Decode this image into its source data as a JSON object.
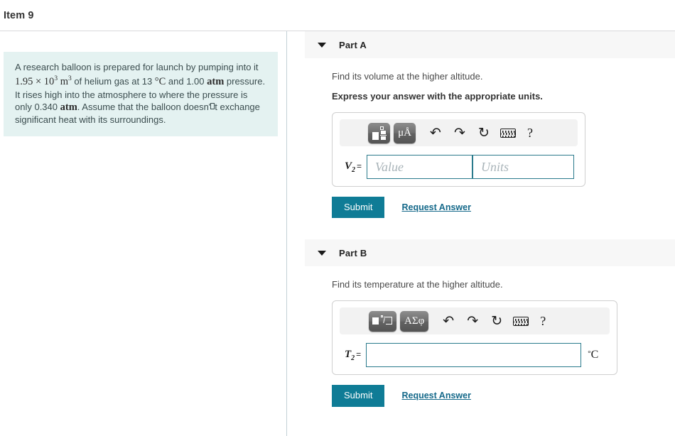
{
  "header": {
    "title": "Item 9"
  },
  "problem": {
    "segments": [
      {
        "type": "text",
        "value": "A research balloon is prepared for launch by pumping into it "
      },
      {
        "type": "math",
        "value": "1.95 × 10"
      },
      {
        "type": "math_sup",
        "value": "3"
      },
      {
        "type": "math_bold",
        "value": " m"
      },
      {
        "type": "math_bold_sup",
        "value": "3"
      },
      {
        "type": "text",
        "value": " of helium gas at 13 "
      },
      {
        "type": "math",
        "value": "°C"
      },
      {
        "type": "text",
        "value": " and 1.00 "
      },
      {
        "type": "math_bold",
        "value": "atm"
      },
      {
        "type": "text",
        "value": " pressure. It rises high into the atmosphere to where the pressure is only 0.340 "
      },
      {
        "type": "math_bold",
        "value": "atm"
      },
      {
        "type": "text",
        "value": ". Assume that the balloon doesn'"
      },
      {
        "type": "missing_glyph",
        "value": ""
      },
      {
        "type": "text",
        "value": "t exchange significant heat with its surroundings."
      }
    ],
    "plain_text": "A research balloon is prepared for launch by pumping into it 1.95 × 10^3 m^3 of helium gas at 13 °C and 1.00 atm pressure. It rises high into the atmosphere to where the pressure is only 0.340 atm. Assume that the balloon doesn'□t exchange significant heat with its surroundings.",
    "background_color": "#e4f2f1"
  },
  "parts": {
    "a": {
      "label": "Part A",
      "caret_icon": "chevron-down-icon",
      "prompt": "Find its volume at the higher altitude.",
      "instruction": "Express your answer with the appropriate units.",
      "toolbar": {
        "template_button": "template-icon",
        "symbols_button": "μÅ",
        "undo_icon": "↶",
        "redo_icon": "↷",
        "reset_icon": "↻",
        "keyboard_icon": "keyboard-icon",
        "help_icon": "?"
      },
      "variable": "V",
      "variable_subscript": "2",
      "equals": "=",
      "value_placeholder": "Value",
      "value": "",
      "units_placeholder": "Units",
      "units": "",
      "submit_label": "Submit",
      "request_answer_label": "Request Answer"
    },
    "b": {
      "label": "Part B",
      "caret_icon": "chevron-down-icon",
      "prompt": "Find its temperature at the higher altitude.",
      "toolbar": {
        "template_button": "radical-icon",
        "symbols_button": "ΑΣφ",
        "undo_icon": "↶",
        "redo_icon": "↷",
        "reset_icon": "↻",
        "keyboard_icon": "keyboard-icon",
        "help_icon": "?"
      },
      "variable": "T",
      "variable_subscript": "2",
      "equals": "=",
      "value_placeholder": "",
      "value": "",
      "unit_suffix_degree": "°",
      "unit_suffix": "C",
      "submit_label": "Submit",
      "request_answer_label": "Request Answer"
    }
  },
  "colors": {
    "accent": "#0f7c96",
    "link": "#15698a",
    "input_border": "#2a7a8c",
    "panel": "#f7f7f7",
    "problem_bg": "#e4f2f1"
  }
}
